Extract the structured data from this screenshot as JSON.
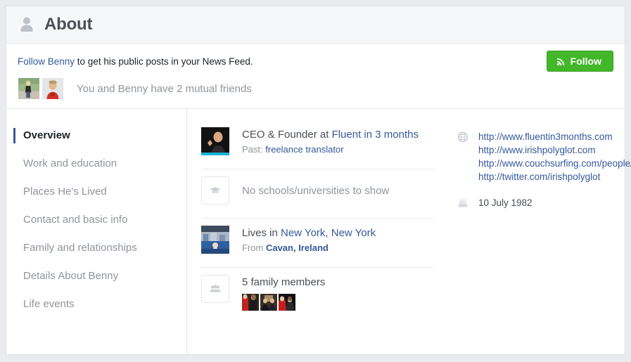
{
  "header": {
    "title": "About",
    "icon": "person-silhouette-icon"
  },
  "follow_strip": {
    "prompt_link": "Follow Benny",
    "prompt_rest": " to get his public posts in your News Feed.",
    "mutual_friends_text": "You and Benny have 2 mutual friends",
    "follow_button_label": "Follow",
    "follow_button_icon": "rss-icon",
    "follow_button_color": "#42b72a"
  },
  "sidebar": {
    "items": [
      {
        "label": "Overview",
        "active": true
      },
      {
        "label": "Work and education",
        "active": false
      },
      {
        "label": "Places He's Lived",
        "active": false
      },
      {
        "label": "Contact and basic info",
        "active": false
      },
      {
        "label": "Family and relationships",
        "active": false
      },
      {
        "label": "Details About Benny",
        "active": false
      },
      {
        "label": "Life events",
        "active": false
      }
    ],
    "active_indicator_color": "#3b5998"
  },
  "overview": {
    "work": {
      "title_prefix": "CEO & Founder at ",
      "title_link": "Fluent in 3 months",
      "sub_prefix": "Past: ",
      "sub_link": "freelance translator",
      "media": "work-thumbnail"
    },
    "education": {
      "text": "No schools/universities to show",
      "icon": "graduation-cap-icon"
    },
    "places": {
      "title_prefix": "Lives in ",
      "title_link": "New York, New York",
      "sub_prefix": "From ",
      "sub_link": "Cavan, Ireland",
      "media": "places-thumbnail"
    },
    "family": {
      "title": "5 family members",
      "icon": "people-group-icon",
      "thumbnail_count": 3
    }
  },
  "contact": {
    "websites_icon": "globe-icon",
    "websites": [
      "http://www.fluentin3months.com",
      "http://www.irishpolyglot.com",
      "http://www.couchsurfing.com/people/irishpolyglot",
      "http://twitter.com/irishpolyglot"
    ],
    "birthday_icon": "birthday-cake-icon",
    "birthday": "10 July 1982"
  },
  "colors": {
    "link": "#365899",
    "text": "#4b4f56",
    "muted": "#90949c",
    "page_bg": "#e9ebee"
  }
}
